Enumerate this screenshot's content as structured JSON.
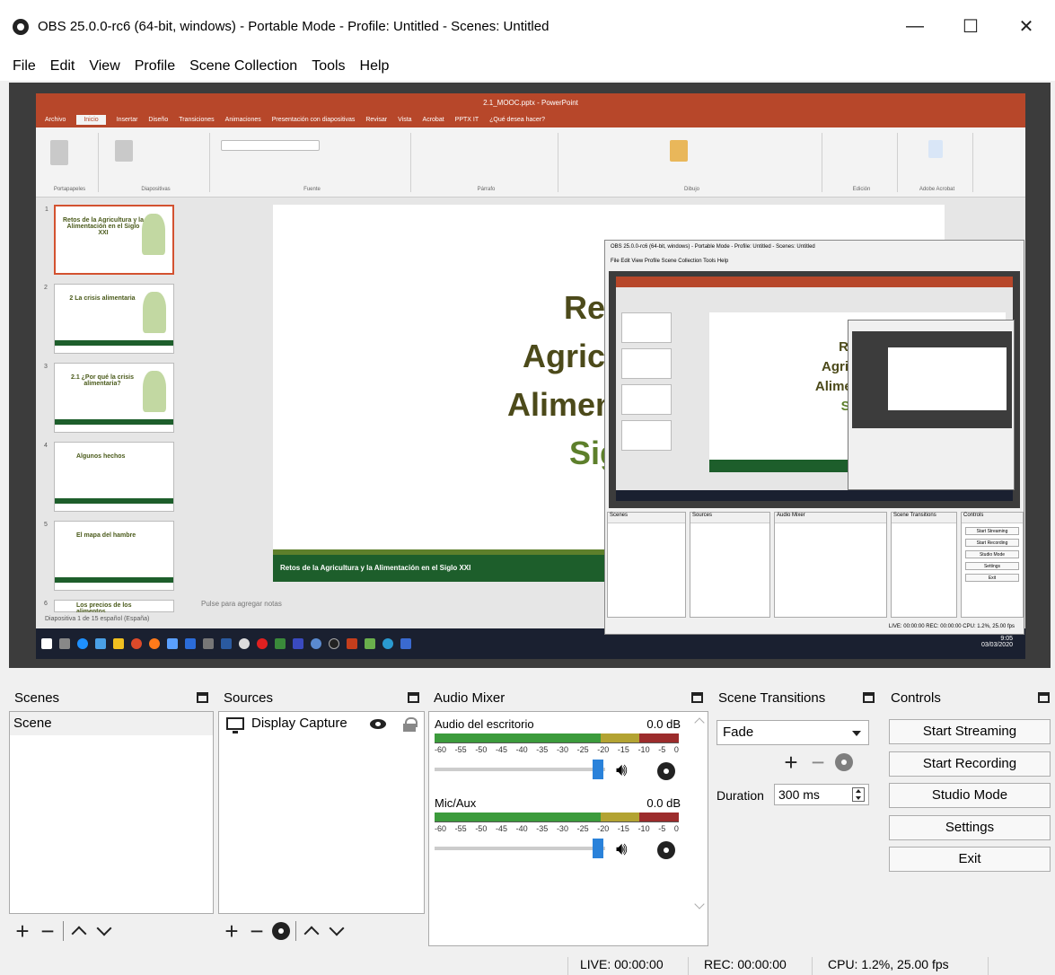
{
  "window": {
    "title": "OBS 25.0.0-rc6 (64-bit, windows) - Portable Mode - Profile: Untitled - Scenes: Untitled",
    "minimize": "—",
    "maximize": "☐",
    "close": "✕"
  },
  "menu": [
    "File",
    "Edit",
    "View",
    "Profile",
    "Scene Collection",
    "Tools",
    "Help"
  ],
  "preview": {
    "powerpoint": {
      "title": "2.1_MOOC.pptx - PowerPoint",
      "tabs": [
        "Archivo",
        "Inicio",
        "Insertar",
        "Diseño",
        "Transiciones",
        "Animaciones",
        "Presentación con diapositivas",
        "Revisar",
        "Vista",
        "Acrobat",
        "PPTX IT",
        "¿Qué desea hacer?"
      ],
      "ribbon_groups": [
        "Portapapeles",
        "Diapositivas",
        "Fuente",
        "Párrafo",
        "Dibujo",
        "Edición",
        "Adobe Acrobat"
      ],
      "thumbnails": [
        {
          "num": "1",
          "text": "Retos de la Agricultura y la Alimentación en el Siglo XXI"
        },
        {
          "num": "2",
          "text": "2 La crisis alimentaria"
        },
        {
          "num": "3",
          "text": "2.1 ¿Por qué la crisis alimentaria?"
        },
        {
          "num": "4",
          "text": "Algunos hechos"
        },
        {
          "num": "5",
          "text": "El mapa del hambre"
        },
        {
          "num": "6",
          "text": "Los precios de los alimentos"
        }
      ],
      "slide_lines": [
        "Retos",
        "Agricultura",
        "Alimentación",
        "Siglo"
      ],
      "slide_footer": "Retos de la Agricultura y la Alimentación en el Siglo XXI",
      "notes_placeholder": "Pulse para agregar notas",
      "status": "Diapositiva 1 de 15    español (España)",
      "clock_time": "9:05",
      "clock_date": "03/03/2020"
    },
    "nested": {
      "title": "OBS 25.0.0-rc6 (64-bit, windows) - Portable Mode - Profile: Untitled - Scenes: Untitled",
      "menu": "File  Edit  View  Profile  Scene Collection  Tools  Help",
      "slide_lines": [
        "Retos",
        "Agricultura",
        "Alimentación",
        "Siglo"
      ],
      "dock_titles": [
        "Scenes",
        "Sources",
        "Audio Mixer",
        "Scene Transitions",
        "Controls"
      ],
      "buttons": [
        "Start Streaming",
        "Start Recording",
        "Studio Mode",
        "Settings",
        "Exit"
      ],
      "status": "LIVE: 00:00:00    REC: 00:00:00    CPU: 1.2%, 25.00 fps"
    }
  },
  "scenes": {
    "title": "Scenes",
    "items": [
      "Scene"
    ]
  },
  "sources": {
    "title": "Sources",
    "items": [
      {
        "name": "Display Capture",
        "visible": true,
        "locked": false
      }
    ]
  },
  "mixer": {
    "title": "Audio Mixer",
    "ticks": [
      "-60",
      "-55",
      "-50",
      "-45",
      "-40",
      "-35",
      "-30",
      "-25",
      "-20",
      "-15",
      "-10",
      "-5",
      "0"
    ],
    "channels": [
      {
        "name": "Audio del escritorio",
        "level": "0.0 dB"
      },
      {
        "name": "Mic/Aux",
        "level": "0.0 dB"
      }
    ]
  },
  "transitions": {
    "title": "Scene Transitions",
    "selected": "Fade",
    "duration_label": "Duration",
    "duration_value": "300 ms"
  },
  "controls": {
    "title": "Controls",
    "buttons": [
      "Start Streaming",
      "Start Recording",
      "Studio Mode",
      "Settings",
      "Exit"
    ]
  },
  "status": {
    "live": "LIVE: 00:00:00",
    "rec": "REC: 00:00:00",
    "cpu": "CPU: 1.2%, 25.00 fps"
  }
}
